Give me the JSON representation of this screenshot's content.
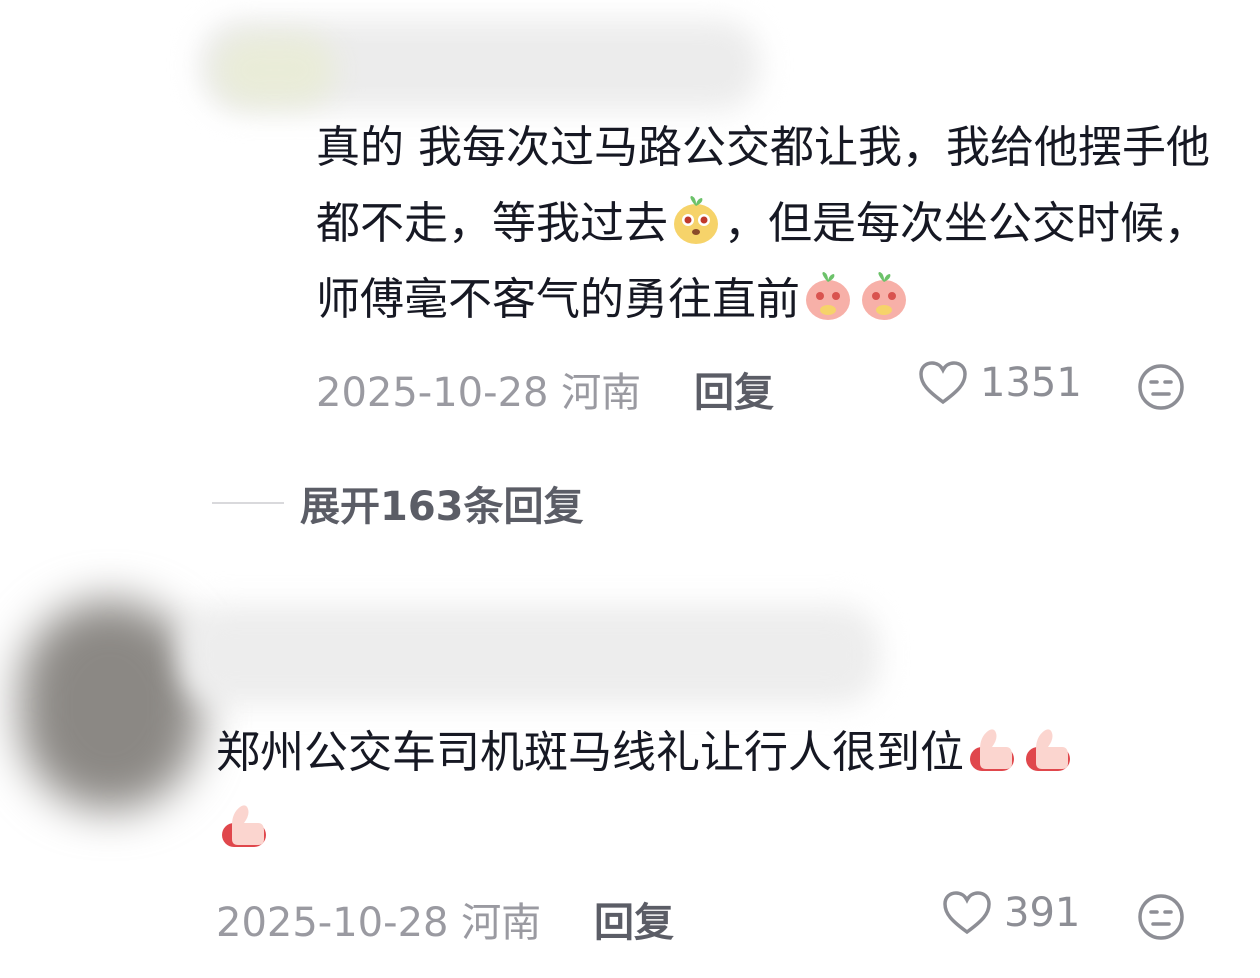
{
  "comment1": {
    "text_part1": "真的 我每次过马路公交都让我，我给他摆手他都不走，等我过去",
    "text_part2": "，但是每次坐公交时候，师傅毫不客气的勇往直前",
    "date": "2025-10-28",
    "location": "河南",
    "reply_label": "回复",
    "likes": "1351",
    "emojis": [
      "surprised-sprout-emoji",
      "shy-sprout-emoji",
      "shy-sprout-emoji"
    ]
  },
  "expand": {
    "label": "展开163条回复"
  },
  "comment2": {
    "text": "郑州公交车司机斑马线礼让行人很到位",
    "date": "2025-10-28",
    "location": "河南",
    "reply_label": "回复",
    "likes": "391",
    "emojis": [
      "thumbs-up-emoji",
      "thumbs-up-emoji",
      "thumbs-up-emoji"
    ]
  },
  "colors": {
    "text": "#161823",
    "meta": "#9a9aa1",
    "reply": "#5b5d66",
    "emoji_pink": "#f7a8a8"
  }
}
